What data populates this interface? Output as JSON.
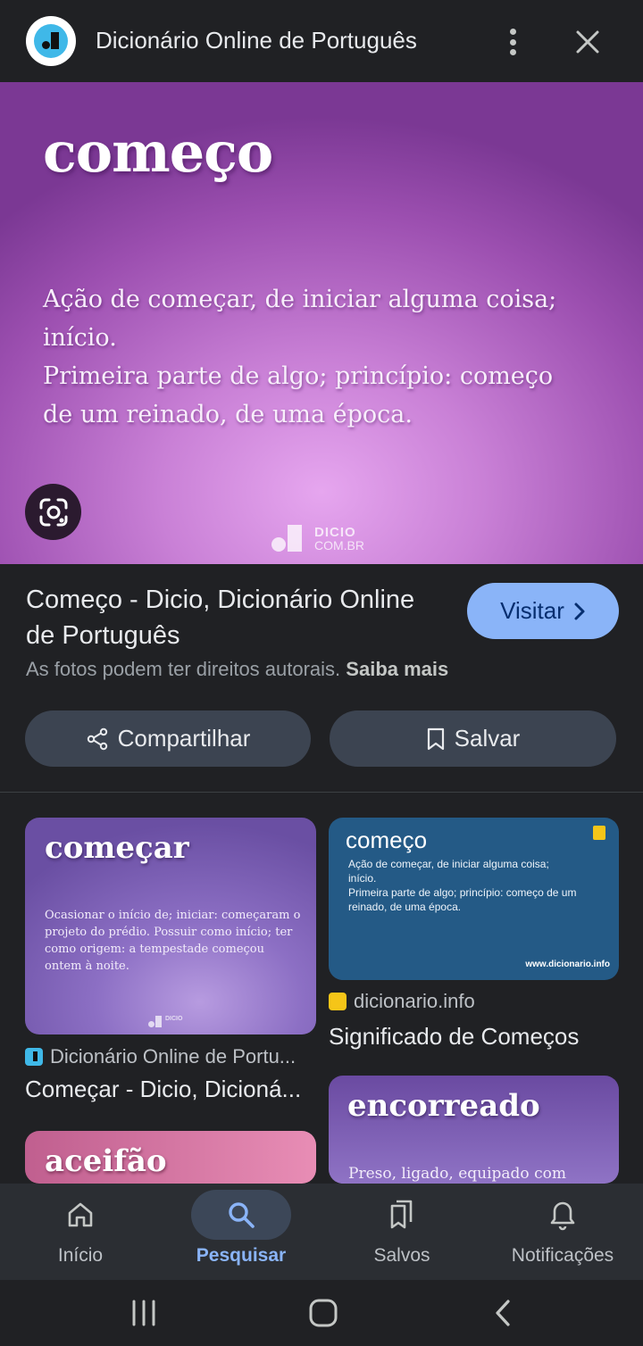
{
  "header": {
    "title": "Dicionário Online de Português",
    "icons": {
      "logo": "dicio-logo-icon",
      "more": "more-vert-icon",
      "close": "close-icon"
    }
  },
  "hero": {
    "word": "começo",
    "definition_lines": [
      "Ação de começar, de iniciar alguma coisa;",
      "início.",
      "Primeira parte de algo; princípio: começo",
      "de um reinado, de uma época."
    ],
    "brand_line1": "DICIO",
    "brand_line2": "COM.BR"
  },
  "result": {
    "title": "Começo - Dicio, Dicionário Online de Português",
    "visit_label": "Visitar",
    "copyright_text": "As fotos podem ter direitos autorais.",
    "learn_more": "Saiba mais",
    "share_label": "Compartilhar",
    "save_label": "Salvar"
  },
  "related": {
    "card1": {
      "word": "começar",
      "definition": "Ocasionar o início de; iniciar: começaram o projeto do prédio. Possuir como início; ter como origem: a tempestade começou ontem à noite.",
      "brand": "DICIO",
      "source": "Dicionário Online de Portu...",
      "title": "Começar - Dicio, Dicioná..."
    },
    "card2": {
      "word": "começo",
      "definition_lines": [
        "Ação de começar, de iniciar alguma coisa;",
        "início.",
        "Primeira parte de algo; princípio: começo de um",
        "reinado, de uma época."
      ],
      "url": "www.dicionario.info",
      "source": "dicionario.info",
      "title": "Significado de Começos"
    },
    "card3": {
      "word": "encorreado",
      "definition": "Preso, ligado, equipado com"
    },
    "card4": {
      "word": "aceifão"
    }
  },
  "bottom_nav": {
    "items": [
      {
        "label": "Início",
        "icon": "home-icon"
      },
      {
        "label": "Pesquisar",
        "icon": "search-icon",
        "active": true
      },
      {
        "label": "Salvos",
        "icon": "bookmarks-icon"
      },
      {
        "label": "Notificações",
        "icon": "bell-icon"
      }
    ]
  },
  "colors": {
    "background": "#202124",
    "accent": "#8ab4f8",
    "hero_purple": "#9c4fb0",
    "button_surface": "#3c4451"
  }
}
